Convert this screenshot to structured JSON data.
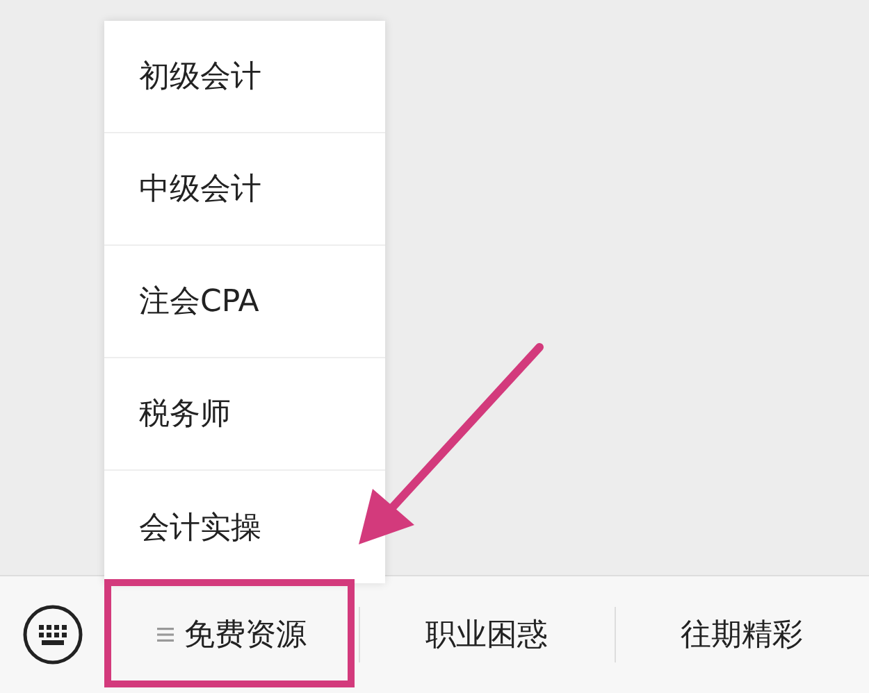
{
  "menu": {
    "items": [
      {
        "label": "初级会计"
      },
      {
        "label": "中级会计"
      },
      {
        "label": "注会CPA"
      },
      {
        "label": "税务师"
      },
      {
        "label": "会计实操"
      }
    ]
  },
  "tabs": [
    {
      "label": "免费资源",
      "expanded": true,
      "highlighted": true
    },
    {
      "label": "职业困惑",
      "expanded": false,
      "highlighted": false
    },
    {
      "label": "往期精彩",
      "expanded": false,
      "highlighted": false
    }
  ]
}
